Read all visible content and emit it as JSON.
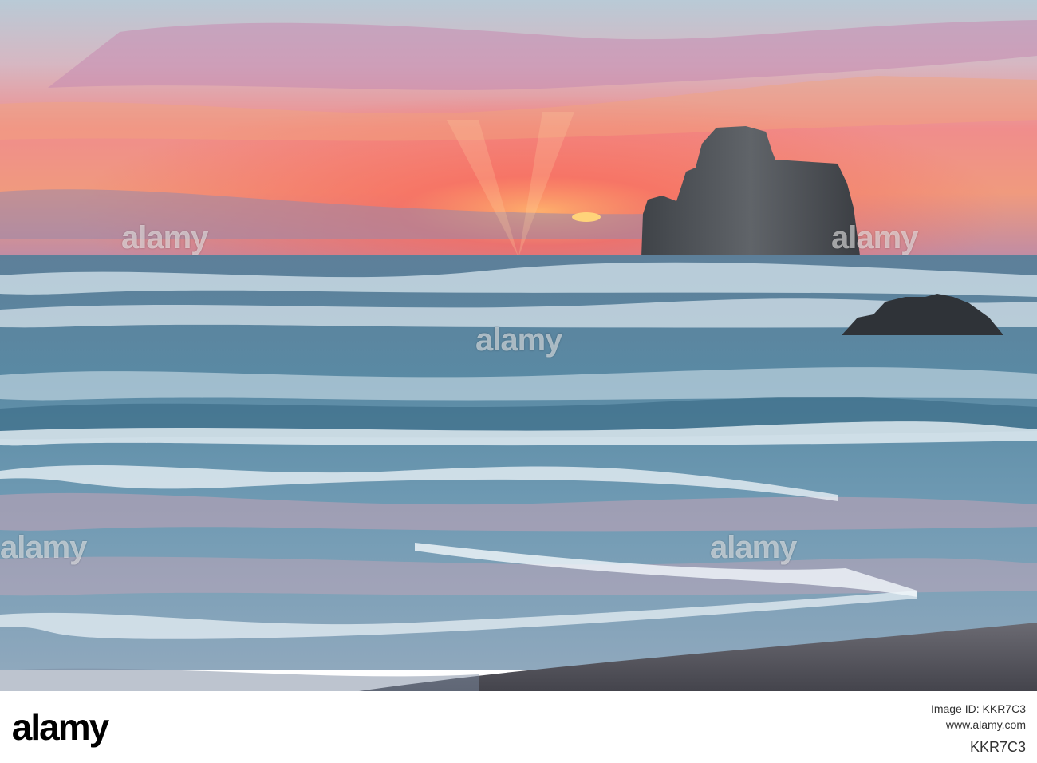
{
  "watermark": {
    "text": "alamy"
  },
  "footer": {
    "logo_text": "alamy",
    "line1": "Image ID: KKR7C3",
    "line2": "www.alamy.com",
    "image_id": "KKR7C3"
  },
  "colors": {
    "sky_top": "#b9c9d4",
    "sky_pink": "#f07f86",
    "sky_orange": "#f5a77b",
    "sun_glow": "#f9665b",
    "sea": "#4f7f98",
    "foam": "#d7e6ee",
    "rock": "#4e5257",
    "sand": "#5b5a5f"
  }
}
